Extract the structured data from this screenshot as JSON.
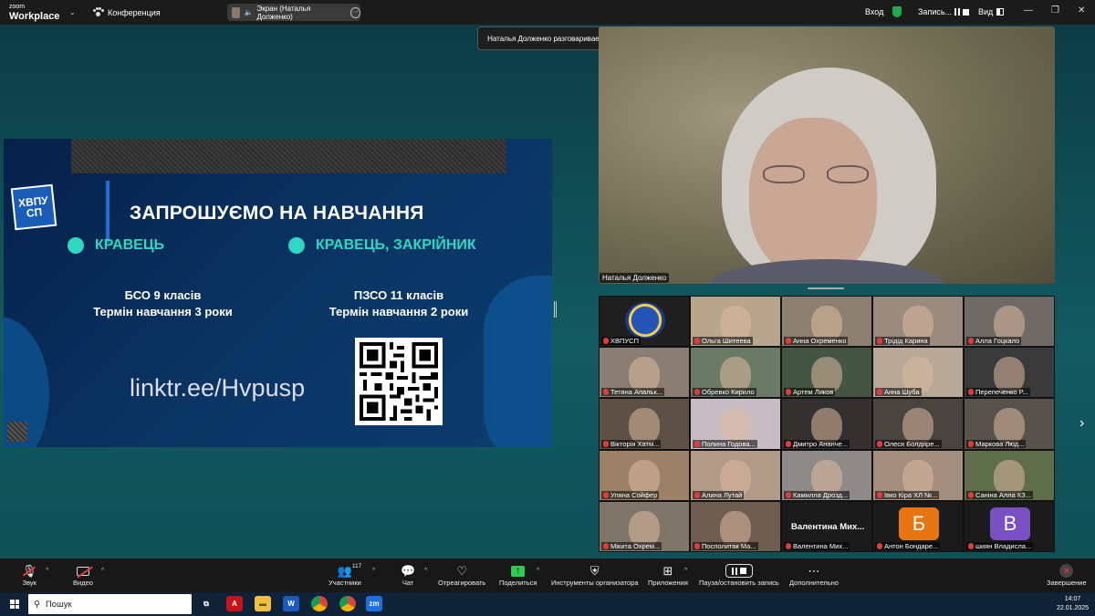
{
  "topbar": {
    "brand_top": "zoom",
    "brand_bottom": "Workplace",
    "meeting_label": "Конференция",
    "screen_label": "Экран (Наталья Долженко)",
    "signin": "Вход",
    "recording": "Запись...",
    "view": "Вид"
  },
  "tooltip": "Наталья Долженко разговаривает...",
  "slide": {
    "logo_top": "ХВПУ",
    "logo_bottom": "СП",
    "title": "ЗАПРОШУЄМО НА НАВЧАННЯ",
    "spec_left": "КРАВЕЦЬ",
    "spec_right": "КРАВЕЦЬ, ЗАКРІЙНИК",
    "left_line1": "БСО  9 класів",
    "left_line2": "Термін навчання 3 роки",
    "right_line1": "ПЗСО  11 класів",
    "right_line2": "Термін навчання 2 роки",
    "link": "linktr.ee/Hvpusp"
  },
  "speaker": {
    "name": "Наталья Долженко"
  },
  "participants": [
    {
      "name": "ХВПУСП",
      "bg": "#1f1f1f",
      "kind": "logo"
    },
    {
      "name": "Ольга Шитеева",
      "bg": "#b8a58c",
      "kind": "video"
    },
    {
      "name": "Анна Охременко",
      "bg": "#8d8070",
      "kind": "video"
    },
    {
      "name": "Трідід Карина",
      "bg": "#9a8b7e",
      "kind": "video"
    },
    {
      "name": "Алла Гоцкало",
      "bg": "#6f6a66",
      "kind": "video"
    },
    {
      "name": "Тетяна  Апальк...",
      "bg": "#8a7e74",
      "kind": "video"
    },
    {
      "name": "Обревко Кирило",
      "bg": "#6b7a66",
      "kind": "video"
    },
    {
      "name": "Артем Ликов",
      "bg": "#445544",
      "kind": "video"
    },
    {
      "name": "Анна Шуба",
      "bg": "#b7a898",
      "kind": "video"
    },
    {
      "name": "Перепеченко Р...",
      "bg": "#3a3a3a",
      "kind": "video"
    },
    {
      "name": "Вікторія Хатм...",
      "bg": "#5c5144",
      "kind": "video"
    },
    {
      "name": "Полина Годова...",
      "bg": "#c7bcc4",
      "kind": "video"
    },
    {
      "name": "Дмитро Ананче...",
      "bg": "#333030",
      "kind": "video"
    },
    {
      "name": "Олеся Болдире...",
      "bg": "#4a4440",
      "kind": "video"
    },
    {
      "name": "Маркова Люд...",
      "bg": "#58524c",
      "kind": "video"
    },
    {
      "name": "Уляна Сойфер",
      "bg": "#9c8166",
      "kind": "video"
    },
    {
      "name": "Алина Лутай",
      "bg": "#b19a88",
      "kind": "video"
    },
    {
      "name": "Камилла Дрозд...",
      "bg": "#8e8a88",
      "kind": "video"
    },
    {
      "name": "Івко Кіра ХЛ №...",
      "bg": "#a48f7f",
      "kind": "video"
    },
    {
      "name": "Саніна Алла КЗ...",
      "bg": "#5f6e4a",
      "kind": "video"
    },
    {
      "name": "Мікита Охрем...",
      "bg": "#7f7568",
      "kind": "video"
    },
    {
      "name": "Посполитак Ма...",
      "bg": "#6f5d52",
      "kind": "video"
    },
    {
      "name": "Валентина Мих...",
      "bg": "#1b1b1b",
      "kind": "name",
      "big": "Валентина  Мих..."
    },
    {
      "name": "Антон Бондаре...",
      "bg": "#1b1b1b",
      "kind": "letter",
      "letter": "Б",
      "color": "#e8750f"
    },
    {
      "name": "шиян Владисла...",
      "bg": "#1b1b1b",
      "kind": "letter",
      "letter": "В",
      "color": "#7b4fc4"
    }
  ],
  "toolbar": {
    "audio": "Звук",
    "video": "Видео",
    "participants": "Участники",
    "participants_count": "117",
    "chat": "Чат",
    "react": "Отреагировать",
    "share": "Поделиться",
    "host_tools": "Инструменты организатора",
    "apps": "Приложения",
    "pause_record": "Пауза/остановить запись",
    "more": "Дополнительно",
    "end": "Завершение"
  },
  "taskbar": {
    "search": "Пошук",
    "time": "14:07",
    "date": "22.01.2025"
  }
}
